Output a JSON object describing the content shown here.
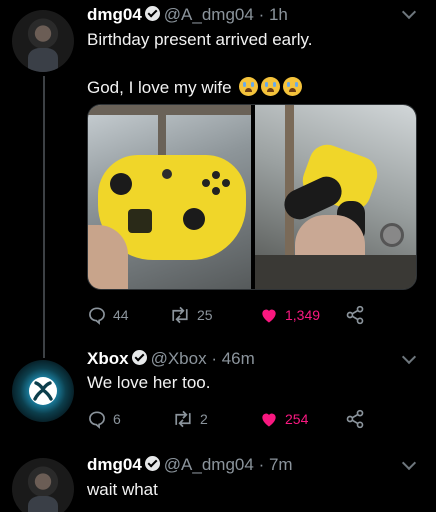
{
  "tweets": [
    {
      "name": "dmg04",
      "handle": "@A_dmg04",
      "time": "1h",
      "lines": [
        "Birthday present arrived early.",
        "God, I love my wife"
      ],
      "emoji": [
        "loudly-crying-face",
        "loudly-crying-face",
        "loudly-crying-face"
      ],
      "media": [
        "yellow-controller-front-photo",
        "yellow-controller-side-photo"
      ],
      "stats": {
        "replies": "44",
        "retweets": "25",
        "likes": "1,349"
      },
      "liked": true
    },
    {
      "name": "Xbox",
      "handle": "@Xbox",
      "time": "46m",
      "lines": [
        "We love her too."
      ],
      "stats": {
        "replies": "6",
        "retweets": "2",
        "likes": "254"
      },
      "liked": true
    },
    {
      "name": "dmg04",
      "handle": "@A_dmg04",
      "time": "7m",
      "lines": [
        "wait what"
      ]
    }
  ],
  "separator": "·",
  "icons": [
    "verified-badge-icon",
    "chevron-down-icon",
    "reply-icon",
    "retweet-icon",
    "heart-icon",
    "share-icon"
  ],
  "colors": {
    "background": "#000000",
    "text": "#e7e9ea",
    "muted": "#8b949c",
    "like": "#f91880",
    "thread_line": "#3d4145"
  }
}
